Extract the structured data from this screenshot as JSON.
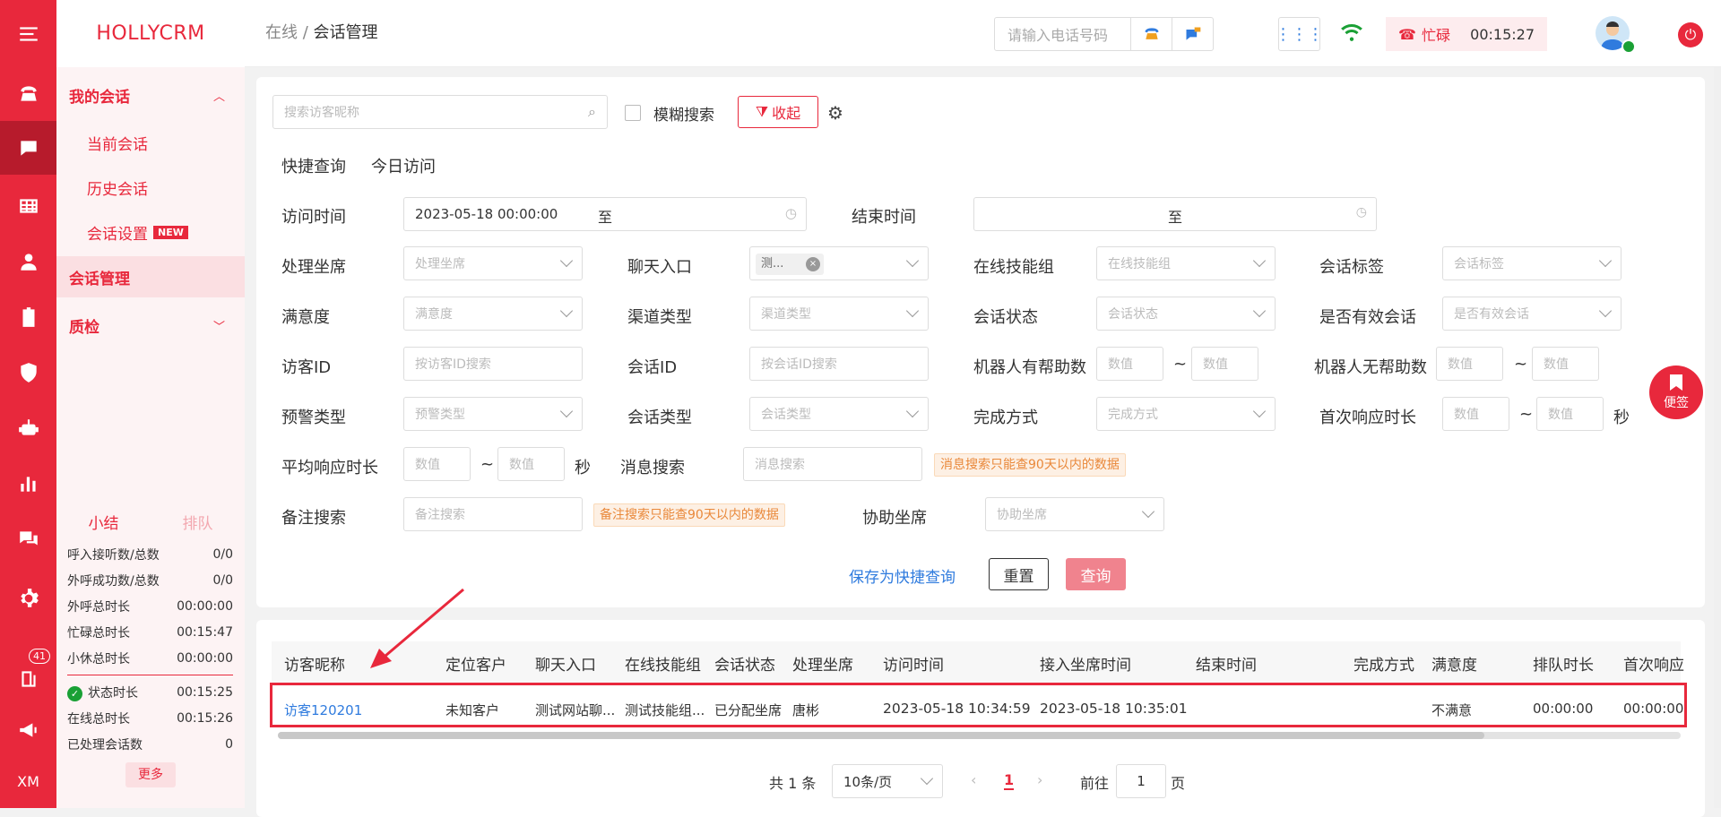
{
  "app": {
    "logo": "HOLLYCRM"
  },
  "rail": {
    "badge_count": "41",
    "footer": "XM"
  },
  "nav": {
    "my_sessions": "我的会话",
    "current": "当前会话",
    "history": "历史会话",
    "settings": "会话设置",
    "new_tag": "NEW",
    "session_mgmt": "会话管理",
    "qc": "质检"
  },
  "stats": {
    "tab_summary": "小结",
    "tab_queue": "排队",
    "rows": [
      {
        "label": "呼入接听数/总数",
        "value": "0/0"
      },
      {
        "label": "外呼成功数/总数",
        "value": "0/0"
      },
      {
        "label": "外呼总时长",
        "value": "00:00:00"
      },
      {
        "label": "忙碌总时长",
        "value": "00:15:47"
      },
      {
        "label": "小休总时长",
        "value": "00:00:00"
      }
    ],
    "rows2": [
      {
        "label": "状态时长",
        "value": "00:15:25"
      },
      {
        "label": "在线总时长",
        "value": "00:15:26"
      },
      {
        "label": "已处理会话数",
        "value": "0"
      }
    ],
    "more": "更多"
  },
  "header": {
    "breadcrumb_1": "在线",
    "breadcrumb_sep": "/",
    "breadcrumb_2": "会话管理",
    "phone_placeholder": "请输入电话号码",
    "status": "忙碌",
    "timer": "00:15:27"
  },
  "filters": {
    "search_placeholder": "搜索访客昵称",
    "fuzzy": "模糊搜索",
    "collapse": "收起",
    "quick_query": "快捷查询",
    "today_visit": "今日访问",
    "visit_time": "访问时间",
    "visit_start": "2023-05-18 00:00:00",
    "to": "至",
    "end_time": "结束时间",
    "agent": "处理坐席",
    "agent_ph": "处理坐席",
    "chat_entry": "聊天入口",
    "chat_entry_tag": "测...",
    "skill_group": "在线技能组",
    "skill_group_ph": "在线技能组",
    "session_tag": "会话标签",
    "session_tag_ph": "会话标签",
    "satisfaction": "满意度",
    "satisfaction_ph": "满意度",
    "channel": "渠道类型",
    "channel_ph": "渠道类型",
    "session_status": "会话状态",
    "session_status_ph": "会话状态",
    "valid": "是否有效会话",
    "valid_ph": "是否有效会话",
    "visitor_id": "访客ID",
    "visitor_id_ph": "按访客ID搜索",
    "session_id": "会话ID",
    "session_id_ph": "按会话ID搜索",
    "bot_helpful": "机器人有帮助数",
    "bot_unhelpful": "机器人无帮助数",
    "num_ph": "数值",
    "tilde": "~",
    "alert": "预警类型",
    "alert_ph": "预警类型",
    "session_type": "会话类型",
    "session_type_ph": "会话类型",
    "finish": "完成方式",
    "finish_ph": "完成方式",
    "first_resp": "首次响应时长",
    "sec": "秒",
    "avg_resp": "平均响应时长",
    "msg_search": "消息搜索",
    "msg_search_ph": "消息搜索",
    "msg_tip": "消息搜索只能查90天以内的数据",
    "note_search": "备注搜索",
    "note_search_ph": "备注搜索",
    "note_tip": "备注搜索只能查90天以内的数据",
    "assist": "协助坐席",
    "assist_ph": "协助坐席",
    "save_quick": "保存为快捷查询",
    "reset": "重置",
    "query": "查询"
  },
  "table": {
    "headers": [
      "访客昵称",
      "定位客户",
      "聊天入口",
      "在线技能组",
      "会话状态",
      "处理坐席",
      "访问时间",
      "接入坐席时间",
      "结束时间",
      "完成方式",
      "满意度",
      "排队时长",
      "首次响应"
    ],
    "row": [
      "访客120201",
      "未知客户",
      "测试网站聊...",
      "测试技能组...",
      "已分配坐席",
      "唐彬",
      "2023-05-18 10:34:59",
      "2023-05-18 10:35:01",
      "",
      "",
      "不满意",
      "00:00:00",
      "00:00:00"
    ]
  },
  "pagination": {
    "total": "共 1 条",
    "per_page": "10条/页",
    "current": "1",
    "goto": "前往",
    "goto_val": "1",
    "page": "页"
  },
  "sticky": {
    "label": "便签"
  },
  "colors": {
    "brand": "#e8283c",
    "link": "#2f7bde",
    "warn": "#e9883a"
  }
}
